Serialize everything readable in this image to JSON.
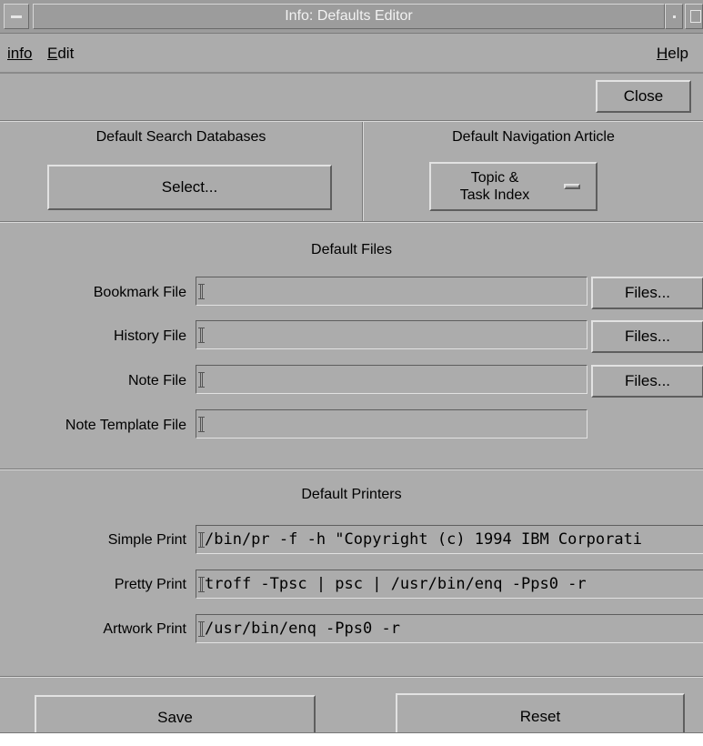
{
  "window": {
    "title": "Info: Defaults Editor"
  },
  "menubar": {
    "info": "info",
    "edit": "Edit",
    "help": "Help"
  },
  "close_label": "Close",
  "search_db": {
    "heading": "Default  Search Databases",
    "select_label": "Select..."
  },
  "nav_article": {
    "heading": "Default Navigation Article",
    "option_line1": "Topic &",
    "option_line2": "Task Index"
  },
  "files": {
    "heading": "Default Files",
    "rows": [
      {
        "label": "Bookmark File",
        "value": "",
        "button": "Files..."
      },
      {
        "label": "History File",
        "value": "",
        "button": "Files..."
      },
      {
        "label": "Note File",
        "value": "",
        "button": "Files..."
      },
      {
        "label": "Note Template File",
        "value": ""
      }
    ]
  },
  "printers": {
    "heading": "Default Printers",
    "rows": [
      {
        "label": "Simple Print",
        "value": "/bin/pr -f -h \"Copyright (c) 1994 IBM Corporati"
      },
      {
        "label": "Pretty Print",
        "value": "troff -Tpsc | psc | /usr/bin/enq -Pps0 -r"
      },
      {
        "label": "Artwork Print",
        "value": "/usr/bin/enq -Pps0 -r"
      }
    ]
  },
  "footer": {
    "save_label": "Save",
    "reset_label": "Reset"
  }
}
